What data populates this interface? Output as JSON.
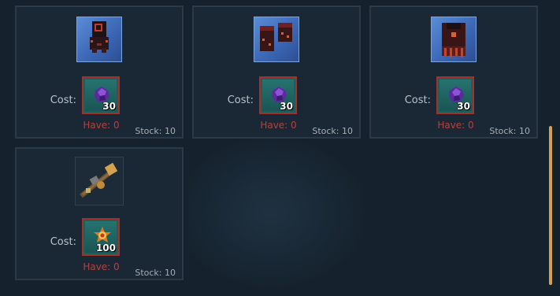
{
  "items": [
    {
      "icon": "dark-helmet-icon",
      "cost_label": "Cost:",
      "currency_icon": "purple-gem-icon",
      "cost_qty": "30",
      "have": "Have: 0",
      "stock": "Stock: 10"
    },
    {
      "icon": "dark-gauntlets-icon",
      "cost_label": "Cost:",
      "currency_icon": "purple-gem-icon",
      "cost_qty": "30",
      "have": "Have: 0",
      "stock": "Stock: 10"
    },
    {
      "icon": "dark-chestplate-icon",
      "cost_label": "Cost:",
      "currency_icon": "purple-gem-icon",
      "cost_qty": "30",
      "have": "Have: 0",
      "stock": "Stock: 10"
    },
    {
      "icon": "crossbow-icon",
      "cost_label": "Cost:",
      "currency_icon": "orange-emblem-icon",
      "cost_qty": "100",
      "have": "Have: 0",
      "stock": "Stock: 10"
    }
  ],
  "colors": {
    "card_border": "#2a3a48",
    "cost_border": "#a33128",
    "have_text": "#b8403c",
    "scrollbar": "#d4a24c",
    "slot_blue": "#4f7ecb"
  }
}
